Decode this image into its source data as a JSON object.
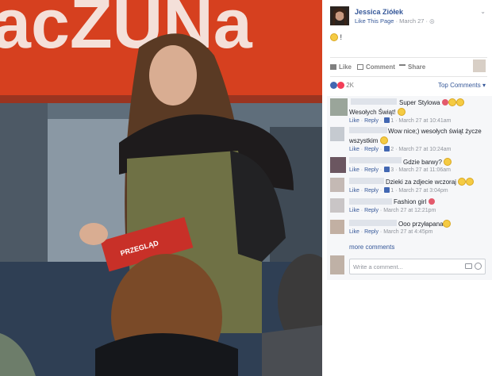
{
  "post": {
    "author": "Jessica Ziółek",
    "like_page": "Like This Page",
    "separator": " · ",
    "date": "March 27",
    "globe": "◎",
    "text": "!",
    "chevron": "⌄"
  },
  "actions": {
    "like": "Like",
    "comment": "Comment",
    "share": "Share"
  },
  "reactions": {
    "count": "2K",
    "top_comments": "Top Comments",
    "sort_arrow": "▾"
  },
  "photo": {
    "banner_text": "acZUNa",
    "card_text": "PRZEGLĄD"
  },
  "comments": [
    {
      "text": "Super Stylowa",
      "meta_like": "Like",
      "meta_reply": "Reply",
      "count": "",
      "time": ""
    },
    {
      "text": "Wesołych Świąt!",
      "meta_like": "Like",
      "meta_reply": "Reply",
      "count": "1",
      "time": "March 27 at 10:41am"
    },
    {
      "text": "Wow nice;) wesołych świąt życze",
      "text2": "wszystkim",
      "meta_like": "Like",
      "meta_reply": "Reply",
      "count": "2",
      "time": "March 27 at 10:24am"
    },
    {
      "text": "Gdzie barwy?",
      "meta_like": "Like",
      "meta_reply": "Reply",
      "count": "3",
      "time": "March 27 at 11:06am"
    },
    {
      "text": "Dzieki za zdjecie wczoraj",
      "meta_like": "Like",
      "meta_reply": "Reply",
      "count": "1",
      "time": "March 27 at 3:04pm"
    },
    {
      "text": "Fashion girl",
      "meta_like": "Like",
      "meta_reply": "Reply",
      "count": "",
      "time": "March 27 at 12:21pm"
    },
    {
      "text": "Ooo przyłapana",
      "meta_like": "Like",
      "meta_reply": "Reply",
      "count": "",
      "time": "March 27 at 4:45pm"
    }
  ],
  "more_comments": "more comments",
  "write_placeholder": "Write a comment...",
  "colors": {
    "link": "#365899",
    "banner": "#d6401f",
    "jacket": "#6f7145"
  }
}
